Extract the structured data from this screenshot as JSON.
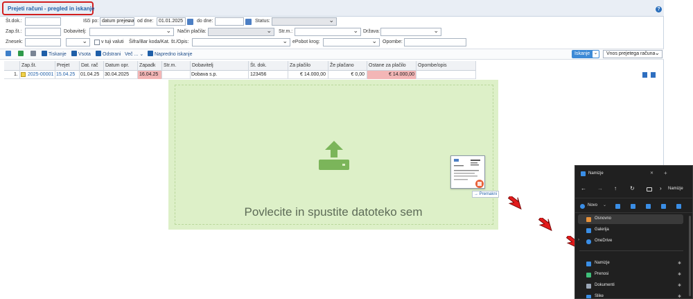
{
  "app": {
    "title": "Prejeti računi - pregled in iskanje",
    "help": "?"
  },
  "filters": {
    "st_dok_label": "Št.dok.:",
    "isci_po_label": "Išči po:",
    "isci_po_value": "datum prejema",
    "od_dne_label": "od dne:",
    "od_dne_value": "01.01.2025",
    "do_dne_label": "do dne:",
    "do_dne_value": "",
    "status_label": "Status:",
    "zap_st_label": "Zap.št.:",
    "dobavitelj_label": "Dobavitelj:",
    "nacin_placila_label": "Način plačila:",
    "str_m_label": "Str.m.:",
    "drzava_label": "Država:",
    "znesek_label": "Znesek:",
    "v_tuji_valuti_label": "v tuji valuti",
    "sifra_label": "Šifra/Bar koda/Kat. št./Opis:",
    "epobot_label": "ePobot krog:",
    "opombe_label": "Opombe:"
  },
  "toolbar": {
    "tiskanje": "Tiskanje",
    "vsota": "Vsota",
    "odstrani": "Odstrani",
    "vec": "Več ...",
    "napredno": "Napredno iskanje",
    "iskanje": "Iskanje",
    "vnos": "Vnos prejetega računa"
  },
  "table": {
    "headers": [
      "Zap.št.",
      "Prejet",
      "Dat. rač",
      "Datum opr.",
      "Zapadk",
      "Str.m.",
      "Dobavitelj",
      "Št. dok.",
      "Za plačilo",
      "Že plačano",
      "Ostane za plačilo",
      "Opombe/opis"
    ],
    "row": {
      "num": "1.",
      "zap_st": "2025-00001",
      "prejet": "15.04.25",
      "dat_rac": "01.04.25",
      "datum_opr": "30.04.2025",
      "zapadk": "16.04.25",
      "str_m": "",
      "dobavitelj": "Dobava s.p.",
      "st_dok": "123456",
      "za_placilo": "€ 14.000,00",
      "ze_placano": "€ 0,00",
      "ostane": "€ 14.000,00"
    }
  },
  "dropzone": {
    "text": "Povlecite in spustite datoteko sem",
    "move_label": "→ Premakni",
    "color": "#ddf0c8"
  },
  "explorer": {
    "title": "Namizje",
    "address": "Namizje",
    "new_label": "Novo",
    "items": [
      {
        "label": "Osnovno",
        "icon": "home-icon",
        "pin": ""
      },
      {
        "label": "Galerija",
        "icon": "gallery-icon",
        "pin": ""
      },
      {
        "label": "OneDrive",
        "icon": "cloud-icon",
        "pin": ""
      },
      {
        "label": "Namizje",
        "icon": "desktop-icon",
        "pin": "✱"
      },
      {
        "label": "Prenosi",
        "icon": "download-icon",
        "pin": "✱"
      },
      {
        "label": "Dokumenti",
        "icon": "document-icon",
        "pin": "✱"
      },
      {
        "label": "Slike",
        "icon": "pictures-icon",
        "pin": "✱"
      }
    ]
  },
  "colors": {
    "accent": "#1f5fa8",
    "highlight_border": "#d21f1f",
    "overdue": "#f3b6b6"
  }
}
